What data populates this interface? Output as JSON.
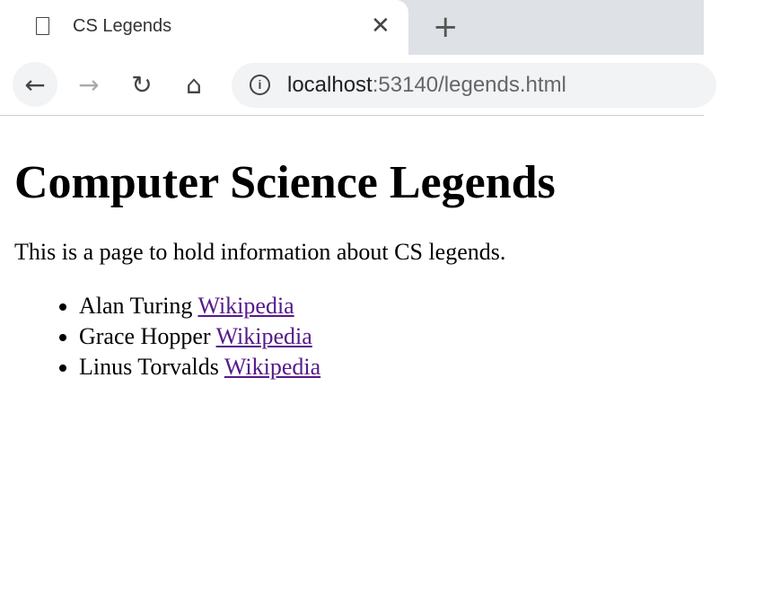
{
  "browser": {
    "tab_title": "CS Legends",
    "url_host": "localhost",
    "url_rest": ":53140/legends.html"
  },
  "icons": {
    "page": "document-icon",
    "close": "close-icon",
    "new_tab": "plus-icon",
    "back": "arrow-left-icon",
    "forward": "arrow-right-icon",
    "reload": "reload-icon",
    "home": "home-icon",
    "info": "info-icon"
  },
  "page": {
    "heading": "Computer Science Legends",
    "intro": "This is a page to hold information about CS legends.",
    "legends": [
      {
        "name": "Alan Turing",
        "link": "Wikipedia"
      },
      {
        "name": "Grace Hopper",
        "link": "Wikipedia"
      },
      {
        "name": "Linus Torvalds",
        "link": "Wikipedia"
      }
    ]
  },
  "colors": {
    "link_visited": "#551a8b",
    "tabstrip": "#dee1e6"
  }
}
